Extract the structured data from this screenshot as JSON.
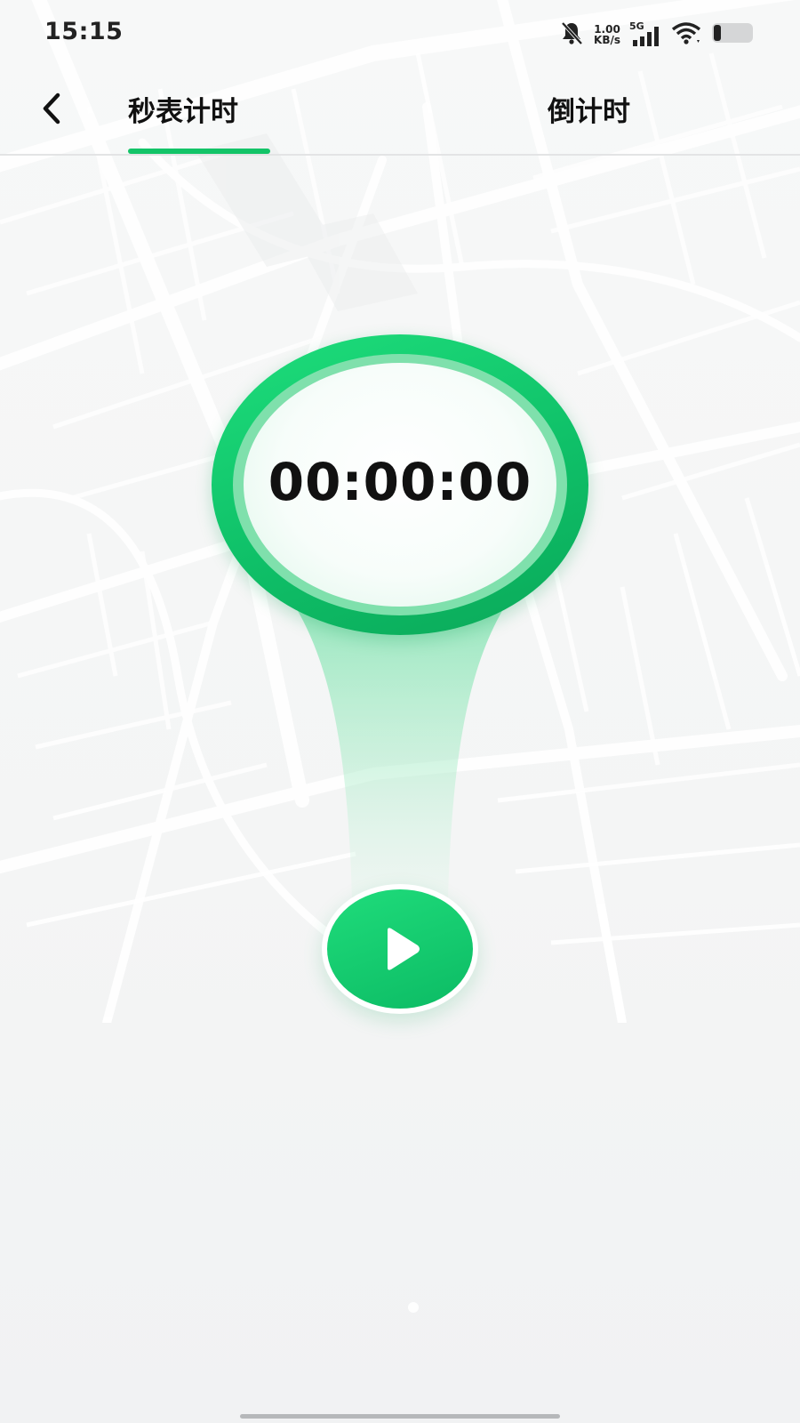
{
  "status_bar": {
    "time": "15:15",
    "net_speed_value": "1.00",
    "net_speed_unit": "KB/s",
    "network_type": "5G",
    "icons": [
      "bell-muted-icon",
      "signal-icon",
      "wifi-icon",
      "battery-icon"
    ]
  },
  "nav": {
    "back_icon": "chevron-left-icon",
    "tabs": [
      {
        "label": "秒表计时",
        "active": true
      },
      {
        "label": "倒计时",
        "active": false
      }
    ]
  },
  "timer": {
    "display": "00:00:00"
  },
  "controls": {
    "play_icon": "play-icon"
  },
  "colors": {
    "accent": "#13c468",
    "accent_light": "#7fe0ac",
    "text": "#111111"
  }
}
